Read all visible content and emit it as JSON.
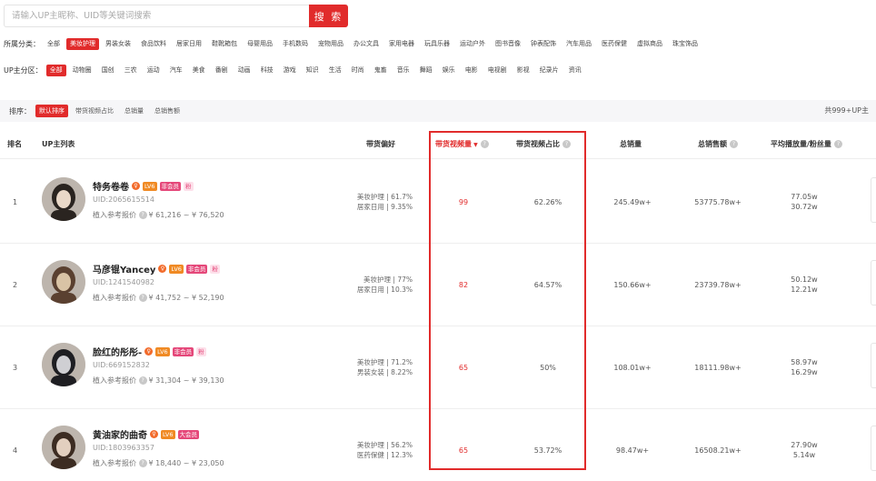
{
  "search": {
    "placeholder": "请输入UP主昵称、UID等关键词搜索",
    "button": "搜 索"
  },
  "category": {
    "label": "所属分类：",
    "items": [
      "全部",
      "美妆护理",
      "男装女装",
      "食品饮料",
      "居家日用",
      "鞋靴箱包",
      "母婴用品",
      "手机数码",
      "宠物用品",
      "办公文具",
      "家用电器",
      "玩具乐器",
      "运动户外",
      "图书音像",
      "钟表配饰",
      "汽车用品",
      "医药保健",
      "虚拟商品",
      "珠宝饰品"
    ],
    "active_index": 1
  },
  "zone": {
    "label": "UP主分区：",
    "items": [
      "全部",
      "动物圈",
      "国创",
      "三农",
      "运动",
      "汽车",
      "美食",
      "番剧",
      "动画",
      "科技",
      "游戏",
      "知识",
      "生活",
      "时尚",
      "鬼畜",
      "音乐",
      "舞蹈",
      "娱乐",
      "电影",
      "电视剧",
      "影视",
      "纪录片",
      "资讯"
    ],
    "active_index": 0
  },
  "sort": {
    "label": "排序：",
    "items": [
      "默认排序",
      "带货视频占比",
      "总销量",
      "总销售额"
    ],
    "active_index": 0,
    "total": "共999+UP主"
  },
  "table": {
    "headers": {
      "rank": "排名",
      "up": "UP主列表",
      "preference": "带货偏好",
      "video_count": "带货视频量",
      "video_ratio": "带货视频占比",
      "total_sales": "总销量",
      "total_gmv": "总销售额",
      "avg_views": "平均播放量/粉丝量"
    },
    "rows": [
      {
        "rank": "1",
        "name": "特务卷卷",
        "level": "LV6",
        "member": "非会员",
        "fan": "粉",
        "uid": "UID:2065615514",
        "price": "植入参考报价",
        "price_range": "¥ 61,216 ~ ¥ 76,520",
        "pref1": "美妆护理 | 61.7%",
        "pref2": "居家日用 | 9.35%",
        "count": "99",
        "ratio": "62.26%",
        "sales": "245.49w+",
        "gmv": "53775.78w+",
        "avg_play": "77.05w",
        "fans": "30.72w"
      },
      {
        "rank": "2",
        "name": "马彦锟Yancey",
        "level": "LV6",
        "member": "非会员",
        "fan": "粉",
        "uid": "UID:1241540982",
        "price": "植入参考报价",
        "price_range": "¥ 41,752 ~ ¥ 52,190",
        "pref1": "美妆护理 | 77%",
        "pref2": "居家日用 | 10.3%",
        "count": "82",
        "ratio": "64.57%",
        "sales": "150.66w+",
        "gmv": "23739.78w+",
        "avg_play": "50.12w",
        "fans": "12.21w"
      },
      {
        "rank": "3",
        "name": "脸红的彤彤-",
        "level": "LV6",
        "member": "非会员",
        "fan": "粉",
        "uid": "UID:669152832",
        "price": "植入参考报价",
        "price_range": "¥ 31,304 ~ ¥ 39,130",
        "pref1": "美妆护理 | 71.2%",
        "pref2": "男装女装 | 8.22%",
        "count": "65",
        "ratio": "50%",
        "sales": "108.01w+",
        "gmv": "18111.98w+",
        "avg_play": "58.97w",
        "fans": "16.29w"
      },
      {
        "rank": "4",
        "name": "黄油家的曲奇",
        "level": "LV6",
        "member": "大会员",
        "fan": "",
        "uid": "UID:1803963357",
        "price": "植入参考报价",
        "price_range": "¥ 18,440 ~ ¥ 23,050",
        "pref1": "美妆护理 | 56.2%",
        "pref2": "医药保健 | 12.3%",
        "count": "65",
        "ratio": "53.72%",
        "sales": "98.47w+",
        "gmv": "16508.21w+",
        "avg_play": "27.90w",
        "fans": "5.14w"
      }
    ]
  },
  "colors": {
    "accent": "#e12b2b",
    "level_badge": "#f08a24",
    "member_badge": "#e5487a"
  }
}
